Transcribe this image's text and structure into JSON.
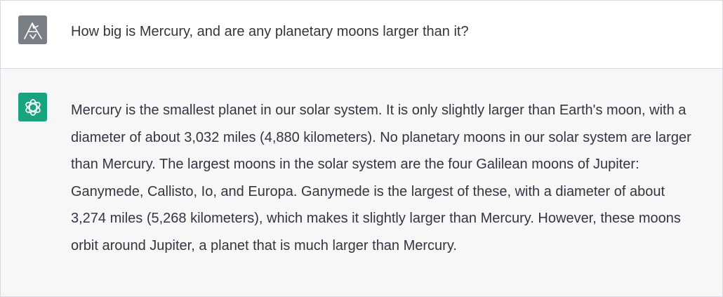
{
  "conversation": {
    "user_message": "How big is Mercury, and are any planetary moons larger than it?",
    "assistant_message": "Mercury is the smallest planet in our solar system. It is only slightly larger than Earth's moon, with a diameter of about 3,032 miles (4,880 kilometers). No planetary moons in our solar system are larger than Mercury. The largest moons in the solar system are the four Galilean moons of Jupiter: Ganymede, Callisto, Io, and Europa. Ganymede is the largest of these, with a diameter of about 3,274 miles (5,268 kilometers), which makes it slightly larger than Mercury. However, these moons orbit around Jupiter, a planet that is much larger than Mercury."
  },
  "avatars": {
    "user_icon": "user-avatar-icon",
    "assistant_icon": "openai-logo-icon",
    "user_color": "#7a7f86",
    "assistant_color": "#19a37f"
  },
  "colors": {
    "text": "#343541",
    "assistant_bg": "#f7f7f8",
    "border": "#d9d9e3"
  }
}
